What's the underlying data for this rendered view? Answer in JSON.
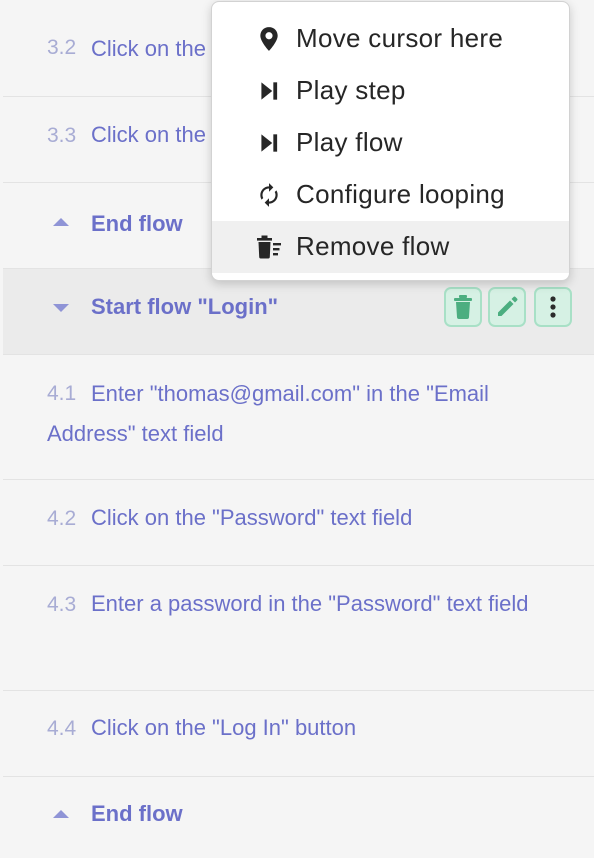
{
  "steps": {
    "s32": {
      "number": "3.2",
      "text": "Click on the \"Username\" text field"
    },
    "s33": {
      "number": "3.3",
      "text": "Click on the \"Log In\" button"
    },
    "end1": {
      "label": "End flow"
    },
    "start_login": {
      "label": "Start flow \"Login\""
    },
    "s41": {
      "number": "4.1",
      "text": "Enter \"thomas@gmail.com\" in the \"Email Address\" text field"
    },
    "s42": {
      "number": "4.2",
      "text": "Click on the \"Password\" text field"
    },
    "s43": {
      "number": "4.3",
      "text": "Enter a password in the \"Password\" text field"
    },
    "s44": {
      "number": "4.4",
      "text": "Click on the \"Log In\" button"
    },
    "end2": {
      "label": "End flow"
    }
  },
  "context_menu": {
    "items": [
      {
        "label": "Move cursor here",
        "icon": "map-pin-icon"
      },
      {
        "label": "Play step",
        "icon": "skip-forward-icon"
      },
      {
        "label": "Play flow",
        "icon": "skip-forward-icon"
      },
      {
        "label": "Configure looping",
        "icon": "loop-icon"
      },
      {
        "label": "Remove flow",
        "icon": "delete-list-icon",
        "highlighted": true
      }
    ]
  },
  "colors": {
    "accent": "#6b70c9",
    "step_number": "#a8acd4",
    "action_button_bg": "#d6f1e4",
    "action_icon": "#4cae80"
  }
}
